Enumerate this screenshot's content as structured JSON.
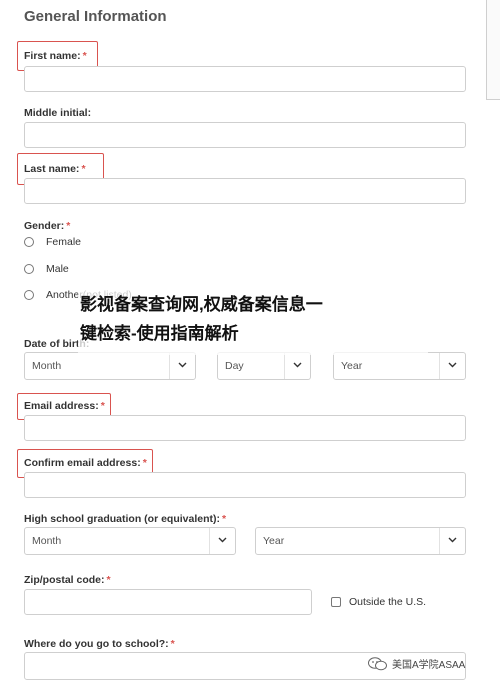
{
  "form": {
    "section_title": "General Information",
    "required_mark": "*",
    "first_name": {
      "label": "First name:"
    },
    "middle_initial": {
      "label": "Middle initial:"
    },
    "last_name": {
      "label": "Last name:"
    },
    "gender": {
      "label": "Gender:",
      "options": [
        "Female",
        "Male",
        "Another(not listed)"
      ]
    },
    "dob": {
      "label": "Date of birth:",
      "month": "Month",
      "day": "Day",
      "year": "Year"
    },
    "email": {
      "label": "Email address:"
    },
    "confirm_email": {
      "label": "Confirm email address:"
    },
    "graduation": {
      "label": "High school graduation (or equivalent):",
      "month": "Month",
      "year": "Year"
    },
    "zip": {
      "label": "Zip/postal code:",
      "outside_us": "Outside the U.S."
    },
    "school": {
      "label": "Where do you go to school?:"
    }
  },
  "overlay": {
    "line1": "影视备案查询网,权威备案信息一",
    "line2": "键检索-使用指南解析"
  },
  "watermark": {
    "text": "美国A学院ASAA"
  },
  "colors": {
    "highlight": "#d9534f",
    "border": "#cfcfcf"
  }
}
